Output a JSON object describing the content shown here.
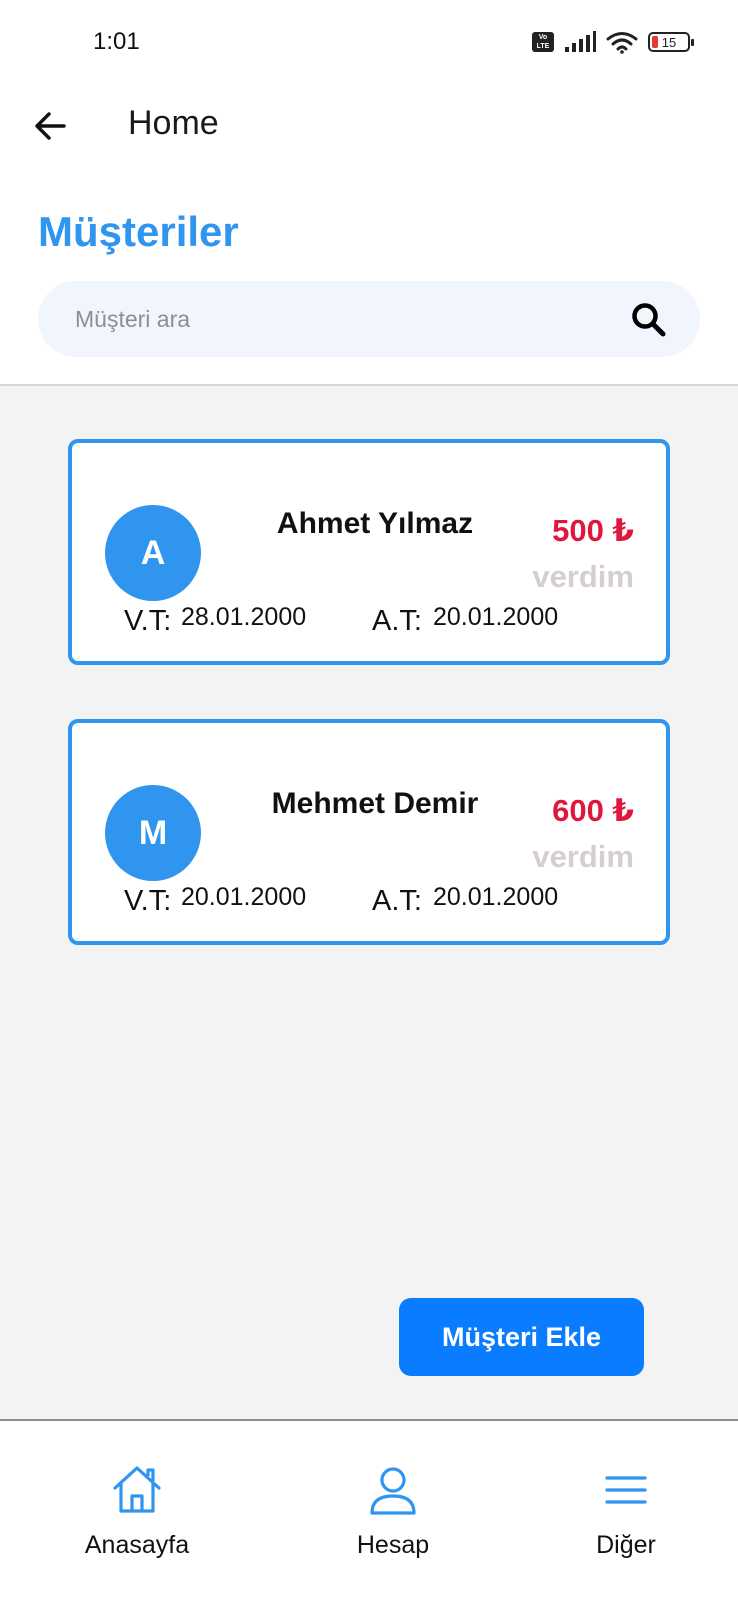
{
  "status_bar": {
    "time": "1:01",
    "volte_label": "Vo LTE",
    "battery": "15"
  },
  "app_bar": {
    "title": "Home",
    "back_icon": "arrow-left-icon"
  },
  "header": {
    "title": "Müşteriler",
    "search": {
      "placeholder": "Müşteri ara",
      "value": "",
      "icon": "search-icon"
    }
  },
  "customers": [
    {
      "initial": "A",
      "name": "Ahmet Yılmaz",
      "amount": "500 ₺",
      "status": "verdim",
      "vt_label": "V.T:",
      "vt_date": "28.01.2000",
      "at_label": "A.T:",
      "at_date": "20.01.2000"
    },
    {
      "initial": "M",
      "name": "Mehmet Demir",
      "amount": "600 ₺",
      "status": "verdim",
      "vt_label": "V.T:",
      "vt_date": "20.01.2000",
      "at_label": "A.T:",
      "at_date": "20.01.2000"
    }
  ],
  "actions": {
    "add_customer": "Müşteri Ekle"
  },
  "bottom_nav": [
    {
      "label": "Anasayfa",
      "icon": "home-icon"
    },
    {
      "label": "Hesap",
      "icon": "user-icon"
    },
    {
      "label": "Diğer",
      "icon": "menu-icon"
    }
  ],
  "colors": {
    "accent": "#2f95ee",
    "button": "#0a7cff",
    "amount": "#e0173d",
    "muted_status": "#d6cece",
    "background": "#f3f3f3"
  }
}
